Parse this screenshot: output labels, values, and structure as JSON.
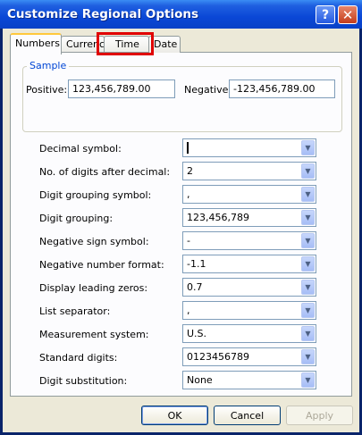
{
  "window": {
    "title": "Customize Regional Options"
  },
  "titlebar": {
    "help_glyph": "?",
    "close_glyph": "✕"
  },
  "tabs": [
    {
      "label": "Numbers",
      "active": true
    },
    {
      "label": "Currency",
      "active": false
    },
    {
      "label": "Time",
      "active": false
    },
    {
      "label": "Date",
      "active": false
    }
  ],
  "sample": {
    "title": "Sample",
    "positive_label": "Positive:",
    "positive_value": "123,456,789.00",
    "negative_label": "Negative:",
    "negative_value": "-123,456,789.00"
  },
  "settings": [
    {
      "label": "Decimal symbol:",
      "value": ""
    },
    {
      "label": "No. of digits after decimal:",
      "value": "2"
    },
    {
      "label": "Digit grouping symbol:",
      "value": ","
    },
    {
      "label": "Digit grouping:",
      "value": "123,456,789"
    },
    {
      "label": "Negative sign symbol:",
      "value": "-"
    },
    {
      "label": "Negative number format:",
      "value": "-1.1"
    },
    {
      "label": "Display leading zeros:",
      "value": "0.7"
    },
    {
      "label": "List separator:",
      "value": ","
    },
    {
      "label": "Measurement system:",
      "value": "U.S."
    },
    {
      "label": "Standard digits:",
      "value": "0123456789"
    },
    {
      "label": "Digit substitution:",
      "value": "None"
    }
  ],
  "buttons": {
    "ok": "OK",
    "cancel": "Cancel",
    "apply": "Apply"
  },
  "colors": {
    "highlight": "#e00000",
    "titlebar": "#0a47d6",
    "tab_hover": "#ffc83c"
  }
}
